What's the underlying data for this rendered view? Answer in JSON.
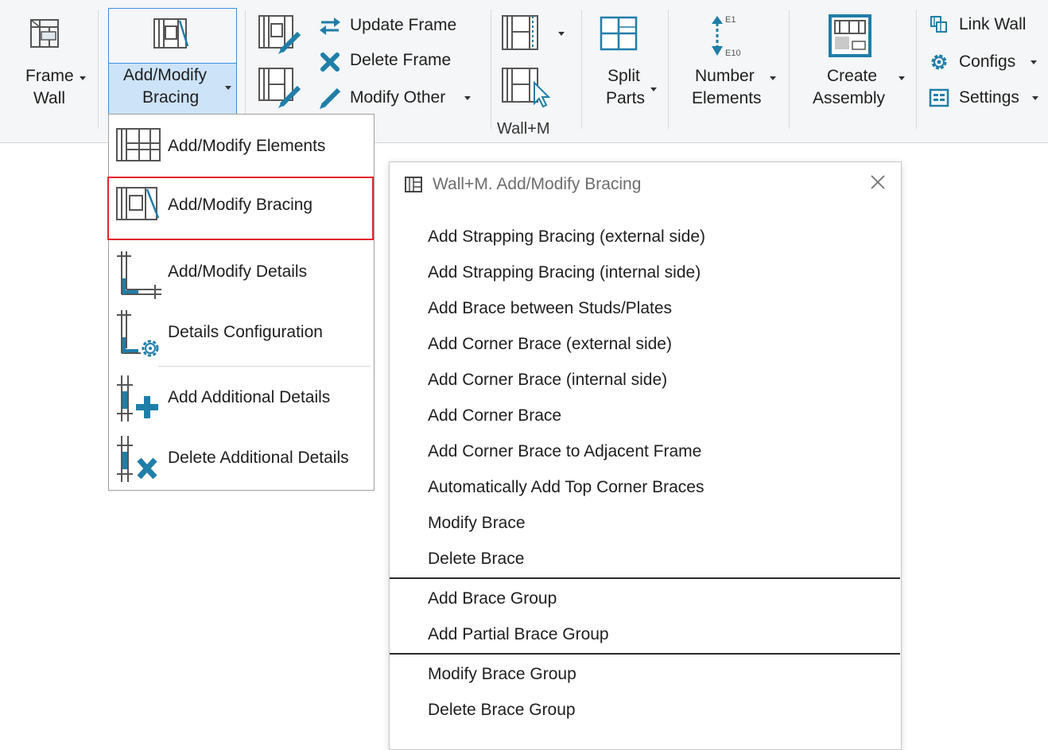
{
  "ribbon": {
    "frame_wall": {
      "line1": "Frame",
      "line2": "Wall"
    },
    "add_modify_bracing": {
      "line1": "Add/Modify",
      "line2": "Bracing"
    },
    "update_frame": "Update Frame",
    "delete_frame": "Delete Frame",
    "modify_other": "Modify Other",
    "panel_label": "Wall+M",
    "split_parts": {
      "line1": "Split",
      "line2": "Parts"
    },
    "number_elements": {
      "line1": "Number",
      "line2": "Elements",
      "tag_top": "E1",
      "tag_bottom": "E10"
    },
    "create_assembly": {
      "line1": "Create",
      "line2": "Assembly"
    },
    "link_wall": "Link Wall",
    "configs": "Configs",
    "settings": "Settings"
  },
  "dropdown": {
    "items": [
      {
        "label": "Add/Modify  Elements"
      },
      {
        "label": "Add/Modify  Bracing"
      },
      {
        "label": "Add/Modify  Details"
      },
      {
        "label": "Details  Configuration"
      },
      {
        "label": "Add Additional  Details"
      },
      {
        "label": "Delete Additional  Details"
      }
    ]
  },
  "dialog": {
    "title": "Wall+M. Add/Modify Bracing",
    "items": [
      "Add Strapping Bracing (external side)",
      "Add Strapping Bracing (internal side)",
      "Add Brace between Studs/Plates",
      "Add Corner Brace (external side)",
      "Add Corner Brace (internal side)",
      "Add Corner Brace",
      "Add Corner Brace to Adjacent Frame",
      "Automatically Add Top Corner Braces",
      "Modify Brace",
      "Delete Brace",
      "Add Brace Group",
      "Add Partial Brace Group",
      "Modify Brace Group",
      "Delete Brace Group"
    ]
  },
  "colors": {
    "accent_blue": "#1e7fd6",
    "highlight_bg": "#cde3f7",
    "highlight_border": "#3a8ee6",
    "red_box": "#e0262c",
    "icon_teal": "#1f7ea8"
  }
}
